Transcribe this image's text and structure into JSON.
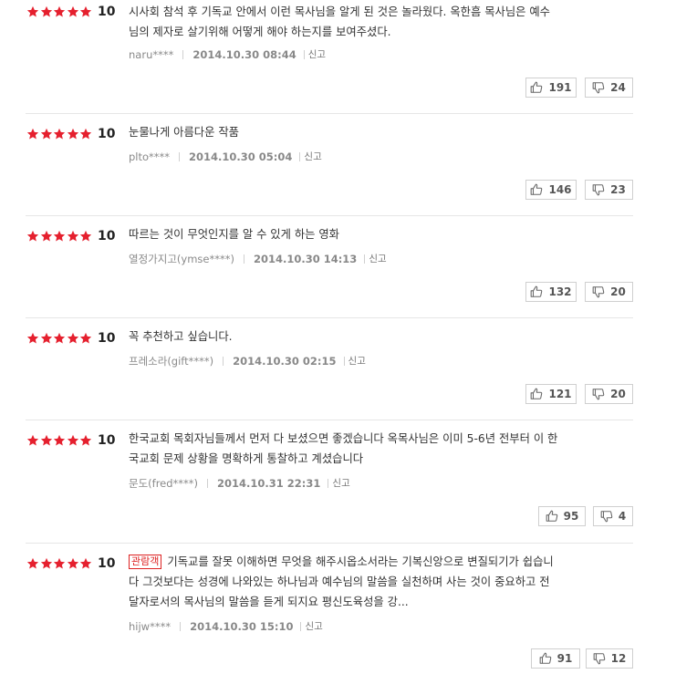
{
  "reviews": [
    {
      "rating": 10,
      "badge": "",
      "lines": [
        "시사회 참석 후 기독교 안에서 이런 목사님을 알게 된 것은 놀라웠다. 옥한흠 목사님은 예수",
        "님의 제자로 살기위해 어떻게 해야 하는지를 보여주셨다."
      ],
      "user": "naru****",
      "date": "2014.10.30 08:44",
      "report": "신고",
      "likes": "191",
      "dislikes": "24"
    },
    {
      "rating": 10,
      "badge": "",
      "lines": [
        "눈물나게 아름다운 작품"
      ],
      "user": "plto****",
      "date": "2014.10.30 05:04",
      "report": "신고",
      "likes": "146",
      "dislikes": "23"
    },
    {
      "rating": 10,
      "badge": "",
      "lines": [
        "따르는 것이 무엇인지를 알 수 있게 하는 영화"
      ],
      "user": "열정가지고(ymse****)",
      "date": "2014.10.30 14:13",
      "report": "신고",
      "likes": "132",
      "dislikes": "20"
    },
    {
      "rating": 10,
      "badge": "",
      "lines": [
        "꼭 추천하고 싶습니다."
      ],
      "user": "프레소라(gift****)",
      "date": "2014.10.30 02:15",
      "report": "신고",
      "likes": "121",
      "dislikes": "20"
    },
    {
      "rating": 10,
      "badge": "",
      "lines": [
        "한국교회 목회자님들께서 먼저 다 보셨으면 좋겠습니다 옥목사님은 이미 5-6년 전부터 이 한",
        "국교회 문제 상황을 명확하게 통찰하고 계셨습니다"
      ],
      "user": "문도(fred****)",
      "date": "2014.10.31 22:31",
      "report": "신고",
      "likes": "95",
      "dislikes": "4"
    },
    {
      "rating": 10,
      "badge": "관람객",
      "lines": [
        "기독교를 잘못 이해하면 무엇을 해주시옵소서라는 기복신앙으로 변질되기가 쉽습니",
        "다 그것보다는 성경에 나와있는 하나님과 예수님의 말씀을 실천하며 사는 것이 중요하고 전",
        "달자로서의 목사님의 말씀을 듣게 되지요 평신도육성을 강..."
      ],
      "user": "hijw****",
      "date": "2014.10.30 15:10",
      "report": "신고",
      "likes": "91",
      "dislikes": "12"
    }
  ],
  "colors": {
    "star": "#e5202e",
    "badge": "#dd2222"
  },
  "icons": {
    "star": "star-icon",
    "like": "thumbs-up-icon",
    "dislike": "thumbs-down-icon"
  }
}
